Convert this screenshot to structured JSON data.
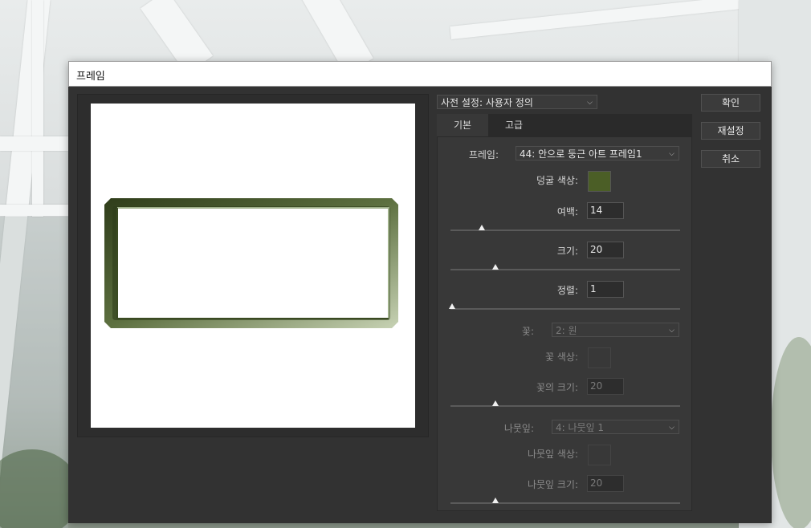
{
  "dialog": {
    "title": "프레임"
  },
  "preset": {
    "label": "사전 설정:",
    "value": "사용자 정의"
  },
  "buttons": {
    "ok": "확인",
    "reset": "재설정",
    "cancel": "취소"
  },
  "tabs": [
    {
      "label": "기본",
      "active": true
    },
    {
      "label": "고급",
      "active": false
    }
  ],
  "basic": {
    "frame": {
      "label": "프레임:",
      "value": "44: 안으로 둥근 아트 프레임1"
    },
    "vine_color": {
      "label": "덩굴 색상:",
      "color": "#4b5e26"
    },
    "margin": {
      "label": "여백:",
      "value": "14",
      "slider": 0.135
    },
    "size": {
      "label": "크기:",
      "value": "20",
      "slider": 0.195
    },
    "arrangement": {
      "label": "정렬:",
      "value": "1",
      "slider": 0.0
    },
    "flower": {
      "label": "꽃:",
      "value": "2: 원",
      "disabled": true
    },
    "flower_color": {
      "label": "꽃 색상:",
      "disabled": true
    },
    "flower_size": {
      "label": "꽃의 크기:",
      "value": "20",
      "slider": 0.195,
      "disabled": true
    },
    "leaf": {
      "label": "나뭇잎:",
      "value": "4: 나뭇잎 1",
      "disabled": true
    },
    "leaf_color": {
      "label": "나뭇잎 색상:",
      "disabled": true
    },
    "leaf_size": {
      "label": "나뭇잎 크기:",
      "value": "20",
      "slider": 0.195,
      "disabled": true
    }
  }
}
